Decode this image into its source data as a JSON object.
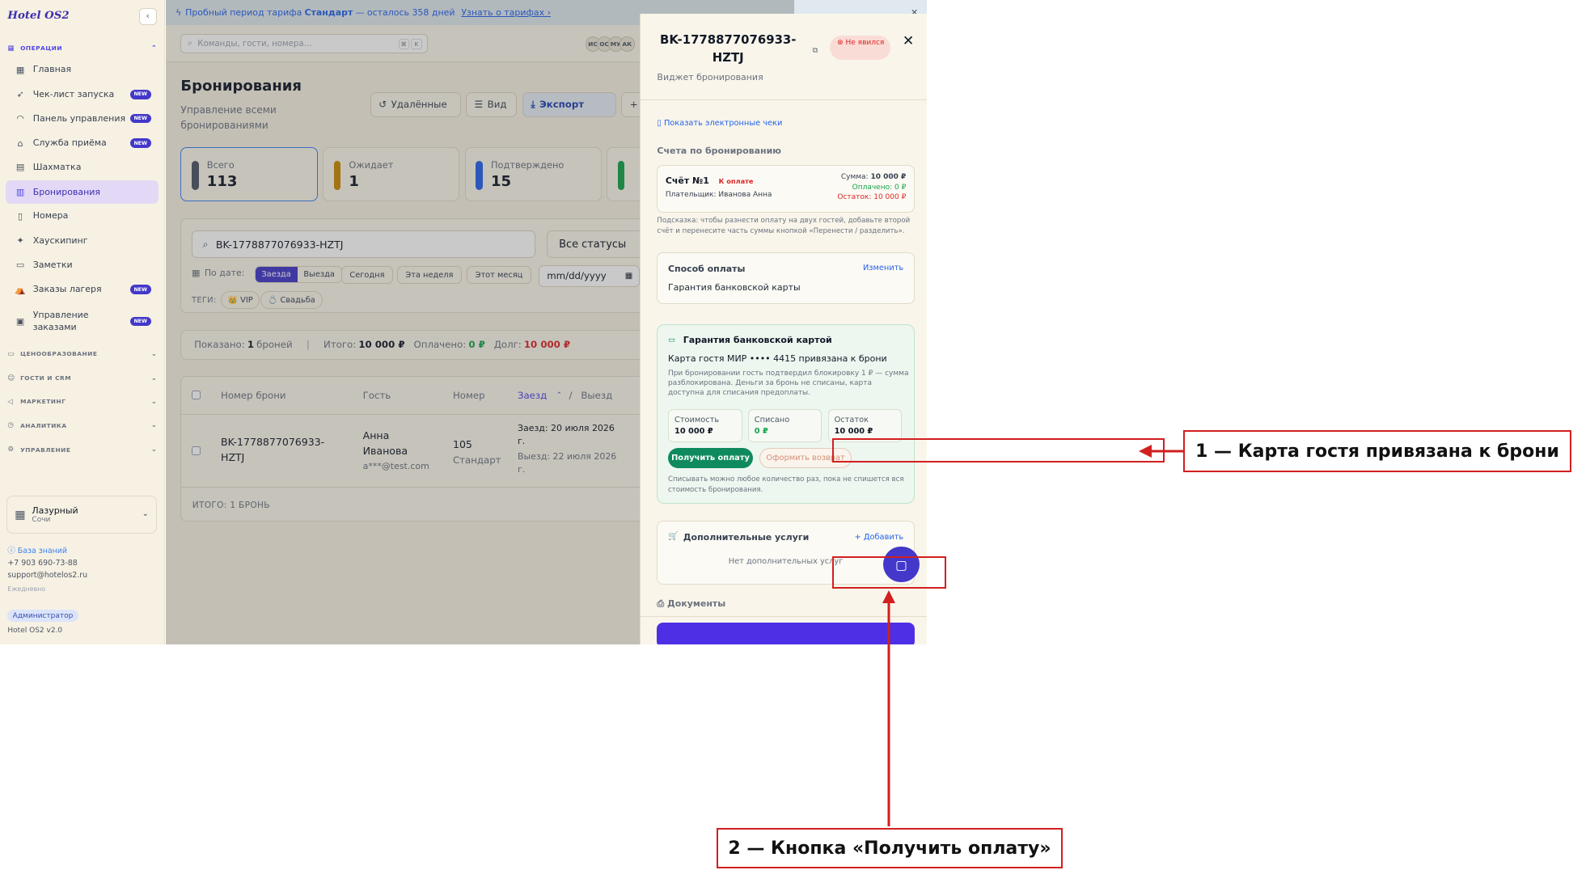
{
  "trial": {
    "text_before": "Пробный период тарифа",
    "plan": "Стандарт",
    "text_after": "— осталось 358 дней",
    "link": "Узнать о тарифах ›"
  },
  "sidebar": {
    "logo": "Hotel OS2",
    "operations_title": "ОПЕРАЦИИ",
    "items": [
      {
        "label": "Главная",
        "new": false
      },
      {
        "label": "Чек-лист запуска",
        "new": true
      },
      {
        "label": "Панель управления",
        "new": true
      },
      {
        "label": "Служба приёма",
        "new": true
      },
      {
        "label": "Шахматка",
        "new": false
      },
      {
        "label": "Бронирования",
        "new": false,
        "active": true
      },
      {
        "label": "Номера",
        "new": false
      },
      {
        "label": "Хаускипинг",
        "new": false
      },
      {
        "label": "Заметки",
        "new": false
      },
      {
        "label": "Заказы лагеря",
        "new": true
      },
      {
        "label": "Управление заказами",
        "new": true
      }
    ],
    "new_badge": "NEW",
    "sections": [
      "ЦЕНООБРАЗОВАНИЕ",
      "ГОСТИ И CRM",
      "МАРКЕТИНГ",
      "АНАЛИТИКА",
      "УПРАВЛЕНИЕ"
    ],
    "hotel": {
      "name": "Лазурный",
      "city": "Сочи"
    },
    "knowledge_base": "База знаний",
    "phone": "+7 903 690-73-88",
    "email": "support@hotelos2.ru",
    "hours": "Ежедневно",
    "role": "Администратор",
    "version": "Hotel OS2 v2.0"
  },
  "topbar": {
    "search_placeholder": "Команды, гости, номера...",
    "kbd1": "⌘",
    "kbd2": "K",
    "avatars": [
      "ИС",
      "ОС",
      "МУ",
      "АК"
    ]
  },
  "page": {
    "title": "Бронирования",
    "subtitle": "Управление всеми бронированиями",
    "btn_deleted": "Удалённые",
    "btn_view": "Вид",
    "btn_export": "Экспорт"
  },
  "stats": [
    {
      "label": "Всего",
      "value": "113",
      "color": "#4b5563"
    },
    {
      "label": "Ожидает",
      "value": "1",
      "color": "#ca8a04"
    },
    {
      "label": "Подтверждено",
      "value": "15",
      "color": "#2563eb"
    }
  ],
  "filters": {
    "search_value": "BK-1778877076933-HZTJ",
    "status": "Все статусы",
    "by_date": "По дате:",
    "seg_checkin": "Заезда",
    "seg_checkout": "Выезда",
    "chips": [
      "Сегодня",
      "Эта неделя",
      "Этот месяц"
    ],
    "date_placeholder": "mm/dd/yyyy",
    "tags_label": "ТЕГИ:",
    "tags": [
      "👑 VIP",
      "💍 Свадьба"
    ]
  },
  "summary": {
    "shown_label": "Показано:",
    "shown_value": "1",
    "shown_unit": "броней",
    "total_label": "Итого:",
    "total_value": "10 000 ₽",
    "paid_label": "Оплачено:",
    "paid_value": "0 ₽",
    "debt_label": "Долг:",
    "debt_value": "10 000 ₽"
  },
  "table": {
    "headers": {
      "number": "Номер брони",
      "guest": "Гость",
      "room": "Номер",
      "checkin": "Заезд",
      "slash": "/",
      "checkout": "Выезд"
    },
    "row": {
      "number": "BK-1778877076933-HZTJ",
      "guest_name": "Анна Иванова",
      "guest_email": "a***@test.com",
      "room_no": "105",
      "room_type": "Стандарт",
      "checkin": "Заезд: 20 июля 2026 г.",
      "checkout": "Выезд: 22 июля 2026 г."
    },
    "footer": "ИТОГО: 1 БРОНЬ"
  },
  "drawer": {
    "title": "BK-1778877076933-HZTJ",
    "status": "Не явился",
    "subtitle": "Виджет бронирования",
    "receipts_link": "Показать электронные чеки",
    "invoices_title": "Счета по бронированию",
    "invoice": {
      "name": "Счёт №1",
      "badge": "К оплате",
      "payer": "Плательщик: Иванова Анна",
      "sum_label": "Сумма:",
      "sum": "10 000 ₽",
      "paid": "Оплачено: 0 ₽",
      "left": "Остаток: 10 000 ₽"
    },
    "hint": "Подсказка: чтобы разнести оплату на двух гостей, добавьте второй счёт и перенесите часть суммы кнопкой «Перенести / разделить».",
    "payment_method_title": "Способ оплаты",
    "payment_method_change": "Изменить",
    "payment_method_value": "Гарантия банковской карты",
    "guarantee": {
      "title": "Гарантия банковской картой",
      "card_line": "Карта гостя МИР •••• 4415 привязана к брони",
      "desc": "При бронировании гость подтвердил блокировку 1 ₽ — сумма разблокирована. Деньги за бронь не списаны, карта доступна для списания предоплаты.",
      "cost_label": "Стоимость",
      "cost": "10 000 ₽",
      "charged_label": "Списано",
      "charged": "0 ₽",
      "rest_label": "Остаток",
      "rest": "10 000 ₽",
      "pay_button": "Получить оплату",
      "refund_button": "Оформить возврат",
      "note": "Списывать можно любое количество раз, пока не спишется вся стоимость бронирования."
    },
    "services_title": "Дополнительные услуги",
    "services_add": "+ Добавить",
    "services_empty": "Нет дополнительных услуг",
    "documents_title": "Документы"
  },
  "annotations": {
    "label1": "1 — Карта гостя привязана к брони",
    "label2": "2 — Кнопка «Получить оплату»"
  }
}
